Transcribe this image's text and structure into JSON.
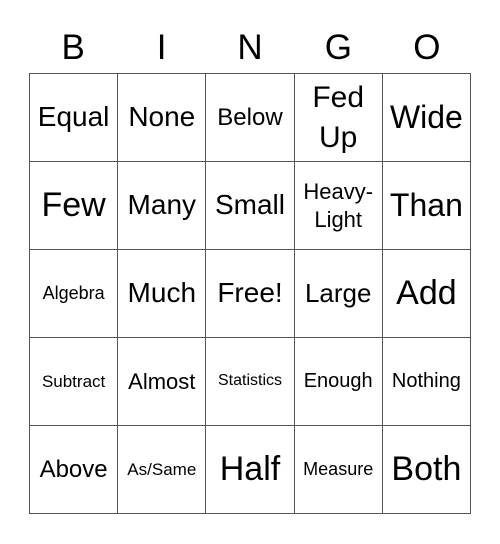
{
  "header": [
    "B",
    "I",
    "N",
    "G",
    "O"
  ],
  "cells": [
    [
      "Equal",
      "None",
      "Below",
      "Fed Up",
      "Wide"
    ],
    [
      "Few",
      "Many",
      "Small",
      "Heavy-Light",
      "Than"
    ],
    [
      "Algebra",
      "Much",
      "Free!",
      "Large",
      "Add"
    ],
    [
      "Subtract",
      "Almost",
      "Statistics",
      "Enough",
      "Nothing"
    ],
    [
      "Above",
      "As/Same",
      "Half",
      "Measure",
      "Both"
    ]
  ],
  "cells_display": {
    "r0c3": [
      "Fed",
      "Up"
    ],
    "r1c3": [
      "Heavy-",
      "Light"
    ]
  }
}
